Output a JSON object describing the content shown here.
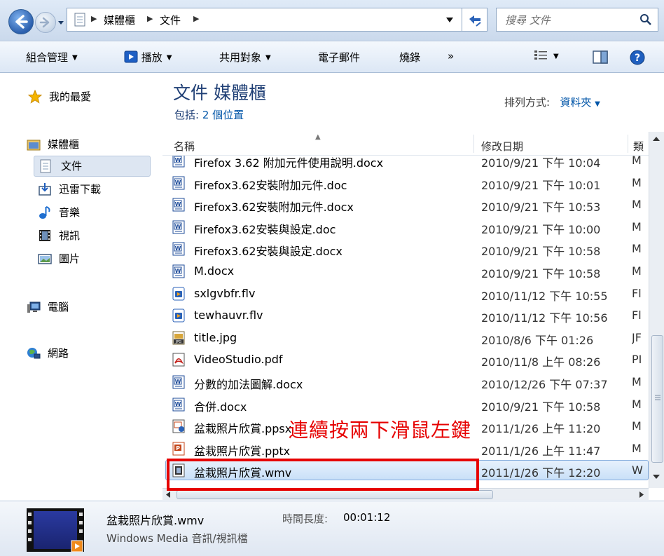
{
  "address_bar": {
    "breadcrumbs": [
      "媒體櫃",
      "文件"
    ],
    "search_placeholder": "搜尋 文件"
  },
  "command_bar": {
    "organize": "組合管理",
    "play": "播放",
    "share": "共用對象",
    "email": "電子郵件",
    "burn": "燒錄",
    "more": "»"
  },
  "nav_pane": {
    "favorites": "我的最愛",
    "libraries": "媒體櫃",
    "library_items": [
      "文件",
      "迅雷下載",
      "音樂",
      "視訊",
      "圖片"
    ],
    "computer": "電腦",
    "network": "網路"
  },
  "library_header": {
    "title": "文件 媒體櫃",
    "includes_label": "包括:",
    "includes_value": "2 個位置",
    "arrange_label": "排列方式:",
    "arrange_value": "資料夾"
  },
  "columns": {
    "name": "名稱",
    "date": "修改日期",
    "type": "類"
  },
  "files": [
    {
      "name": "Firefox 3.62 附加元件使用說明.docx",
      "date": "2010/9/21 下午 10:04",
      "type": "M",
      "icon": "word-doc-icon"
    },
    {
      "name": "Firefox3.62安裝附加元件.doc",
      "date": "2010/9/21 下午 10:01",
      "type": "M",
      "icon": "word-doc-icon"
    },
    {
      "name": "Firefox3.62安裝附加元件.docx",
      "date": "2010/9/21 下午 10:53",
      "type": "M",
      "icon": "word-doc-icon"
    },
    {
      "name": "Firefox3.62安裝與設定.doc",
      "date": "2010/9/21 下午 10:00",
      "type": "M",
      "icon": "word-doc-icon"
    },
    {
      "name": "Firefox3.62安裝與設定.docx",
      "date": "2010/9/21 下午 10:58",
      "type": "M",
      "icon": "word-doc-icon"
    },
    {
      "name": "M.docx",
      "date": "2010/9/21 下午 10:58",
      "type": "M",
      "icon": "word-doc-icon"
    },
    {
      "name": "sxlgvbfr.flv",
      "date": "2010/11/12 下午 10:55",
      "type": "Fl",
      "icon": "flv-video-icon"
    },
    {
      "name": "tewhauvr.flv",
      "date": "2010/11/12 下午 10:56",
      "type": "Fl",
      "icon": "flv-video-icon"
    },
    {
      "name": "title.jpg",
      "date": "2010/8/6 下午 01:26",
      "type": "JF",
      "icon": "jpg-image-icon"
    },
    {
      "name": "VideoStudio.pdf",
      "date": "2010/11/8 上午 08:26",
      "type": "PI",
      "icon": "pdf-icon"
    },
    {
      "name": "分數的加法圖解.docx",
      "date": "2010/12/26 下午 07:37",
      "type": "M",
      "icon": "word-doc-icon"
    },
    {
      "name": "合併.docx",
      "date": "2010/9/21 下午 10:58",
      "type": "M",
      "icon": "word-doc-icon"
    },
    {
      "name": "盆栽照片欣賞.ppsx",
      "date": "2011/1/26 上午 11:20",
      "type": "M",
      "icon": "ppsx-icon"
    },
    {
      "name": "盆栽照片欣賞.pptx",
      "date": "2011/1/26 上午 11:47",
      "type": "M",
      "icon": "pptx-icon"
    },
    {
      "name": "盆栽照片欣賞.wmv",
      "date": "2011/1/26 下午 12:20",
      "type": "W",
      "icon": "wmv-video-icon",
      "selected": true
    }
  ],
  "annotation": "連續按兩下滑鼠左鍵",
  "details": {
    "file_name": "盆栽照片欣賞.wmv",
    "duration_label": "時間長度:",
    "duration": "00:01:12",
    "file_type": "Windows Media 音訊/視訊檔"
  },
  "colors": {
    "annotation_red": "#e60000",
    "selection_blue": "#c9e0f8",
    "title_blue": "#1f3f75"
  }
}
